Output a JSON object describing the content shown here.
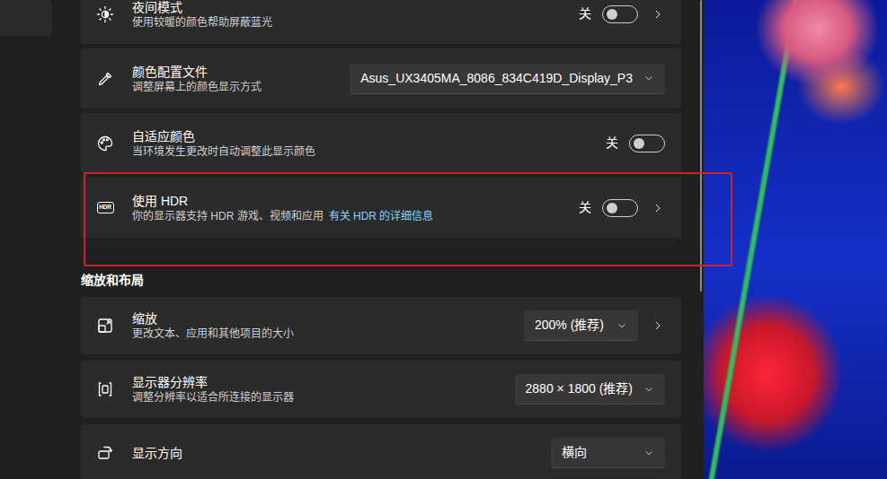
{
  "settings": [
    {
      "kind": "toggle",
      "title": "夜间模式",
      "subtitle": "使用较暖的颜色帮助屏蔽蓝光",
      "state_label": "关",
      "on": false,
      "has_details": true
    },
    {
      "kind": "dropdown",
      "title": "颜色配置文件",
      "subtitle": "调整屏幕上的颜色显示方式",
      "value": "Asus_UX3405MA_8086_834C419D_Display_P3",
      "has_details": false
    },
    {
      "kind": "toggle",
      "title": "自适应颜色",
      "subtitle": "当环境发生更改时自动调整此显示颜色",
      "state_label": "关",
      "on": false,
      "has_details": false
    },
    {
      "kind": "toggle",
      "title": "使用 HDR",
      "subtitle": "你的显示器支持 HDR 游戏、视频和应用",
      "link": "有关 HDR 的详细信息",
      "icon_label": "HDR",
      "state_label": "关",
      "on": false,
      "has_details": true,
      "highlighted": true
    }
  ],
  "section_heading": "缩放和布局",
  "layout_settings": [
    {
      "kind": "dropdown",
      "title": "缩放",
      "subtitle": "更改文本、应用和其他项目的大小",
      "value": "200% (推荐)",
      "has_details": true
    },
    {
      "kind": "dropdown",
      "title": "显示器分辨率",
      "subtitle": "调整分辨率以适合所连接的显示器",
      "value": "2880 × 1800 (推荐)",
      "has_details": false
    },
    {
      "kind": "dropdown",
      "title": "显示方向",
      "value": "横向",
      "has_details": false
    }
  ]
}
